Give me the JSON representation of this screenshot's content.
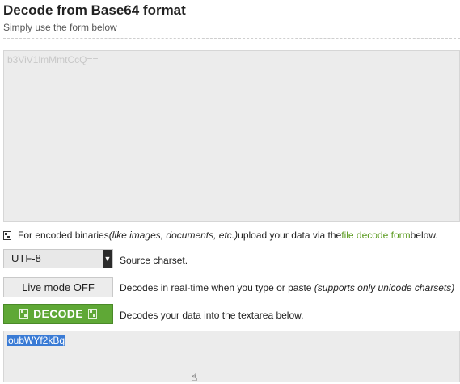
{
  "page": {
    "title": "Decode from Base64 format",
    "subtitle": "Simply use the form below"
  },
  "input": {
    "placeholder": "b3ViV1lmMmtCcQ=="
  },
  "file_note": {
    "prefix": "For encoded binaries ",
    "italic": "(like images, documents, etc.)",
    "middle": " upload your data via the ",
    "link": "file decode form",
    "suffix": " below."
  },
  "charset": {
    "selected": "UTF-8",
    "description": "Source charset."
  },
  "live_mode": {
    "label": "Live mode OFF",
    "description": "Decodes in real-time when you type or paste ",
    "description_italic": "(supports only unicode charsets)"
  },
  "decode": {
    "label": "DECODE",
    "description": "Decodes your data into the textarea below."
  },
  "output": {
    "value": "oubWYf2kBq"
  },
  "icons": {
    "file": "file-icon",
    "dropdown": "chevron-down-icon",
    "cursor": "hand-cursor-icon"
  }
}
